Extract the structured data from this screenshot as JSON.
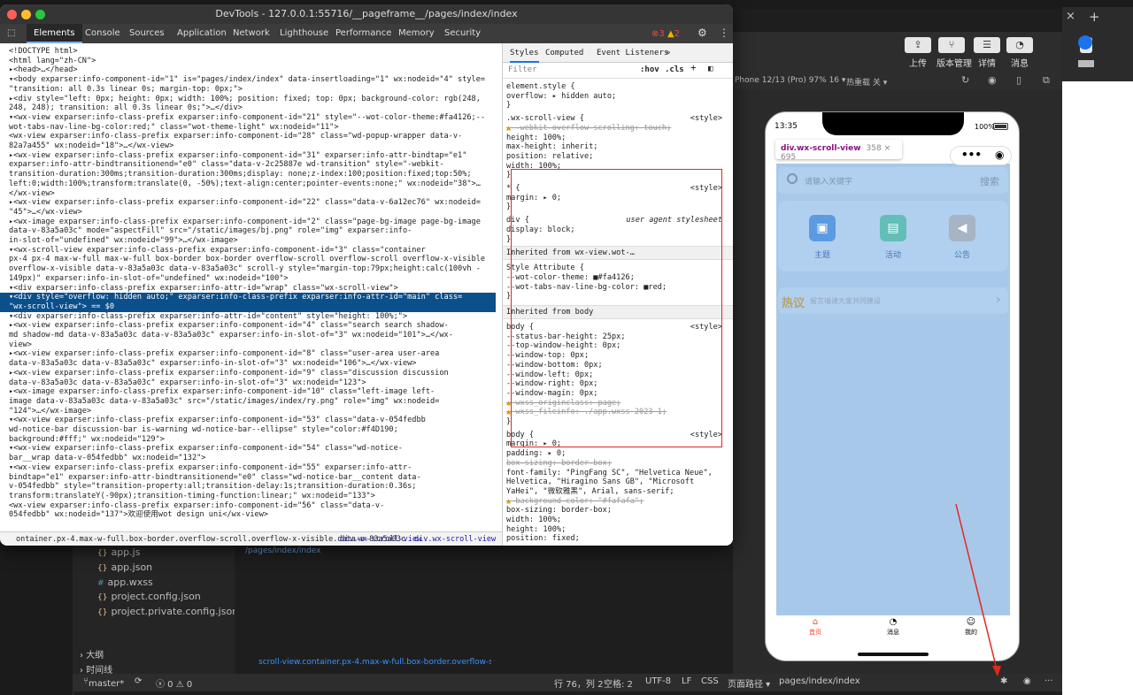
{
  "devtools": {
    "title": "DevTools - 127.0.0.1:55716/__pageframe__/pages/index/index",
    "tabs": [
      "Elements",
      "Console",
      "Sources",
      "Application",
      "Network",
      "Lighthouse",
      "Performance",
      "Memory",
      "Security"
    ],
    "errors": "3",
    "warnings": "2",
    "elements_lines": [
      "<!DOCTYPE html>",
      "<html lang=\"zh-CN\">",
      "▸<head>…</head>",
      "▾<body exparser:info-component-id=\"1\" is=\"pages/index/index\" data-insertloading=\"1\" wx:nodeid=\"4\" style=",
      "\"transition: all 0.3s linear 0s; margin-top: 0px;\">",
      "  ▸<div style=\"left: 0px; height: 0px; width: 100%; position: fixed; top: 0px; background-color: rgb(248,",
      "  248, 248); transition: all 0.3s linear 0s;\">…</div>",
      "  ▾<wx-view exparser:info-class-prefix exparser:info-component-id=\"21\" style=\"--wot-color-theme:#fa4126;--",
      "  wot-tabs-nav-line-bg-color:red;\" class=\"wot-theme-light\" wx:nodeid=\"11\">",
      "     <wx-view exparser:info-class-prefix exparser:info-component-id=\"28\" class=\"wd-popup-wrapper data-v-",
      "     82a7a455\" wx:nodeid=\"18\">…</wx-view>",
      "   ▸<wx-view exparser:info-class-prefix exparser:info-component-id=\"31\" exparser:info-attr-bindtap=\"e1\"",
      "   exparser:info-attr-bindtransitionend=\"e0\" class=\"data-v-2c25887e wd-transition\" style=\"-webkit-",
      "   transition-duration:300ms;transition-duration:300ms;display: none;z-index:100;position:fixed;top:50%;",
      "   left:0;width:100%;transform:translate(0, -50%);text-align:center;pointer-events:none;\" wx:nodeid=\"38\">…",
      "   </wx-view>",
      "   ▸<wx-view exparser:info-class-prefix exparser:info-component-id=\"22\" class=\"data-v-6a12ec76\" wx:nodeid=",
      "   \"45\">…</wx-view>",
      "   ▸<wx-image exparser:info-class-prefix exparser:info-component-id=\"2\" class=\"page-bg-image page-bg-image",
      "   data-v-83a5a03c\" mode=\"aspectFill\" src=\"/static/images/bj.png\" role=\"img\" exparser:info-",
      "   in-slot-of=\"undefined\" wx:nodeid=\"99\">…</wx-image>",
      "   ▾<wx-scroll-view exparser:info-class-prefix exparser:info-component-id=\"3\" class=\"container",
      "   px-4 px-4 max-w-full max-w-full box-border box-border overflow-scroll overflow-scroll overflow-x-visible",
      "   overflow-x-visible data-v-83a5a03c data-v-83a5a03c\" scroll-y style=\"margin-top:79px;height:calc(100vh -",
      "   149px)\" exparser:info-in-slot-of=\"undefined\" wx:nodeid=\"100\">",
      "     ▾<div exparser:info-class-prefix exparser:info-attr-id=\"wrap\" class=\"wx-scroll-view\">",
      "       ▾<div style=\"overflow: hidden auto;\" exparser:info-class-prefix exparser:info-attr-id=\"main\" class=",
      "       \"wx-scroll-view\"> == $0",
      "         ▾<div exparser:info-class-prefix exparser:info-attr-id=\"content\" style=\"height: 100%;\">",
      "           ▸<wx-view exparser:info-class-prefix exparser:info-component-id=\"4\" class=\"search search shadow-",
      "           md shadow-md data-v-83a5a03c data-v-83a5a03c\" exparser:info-in-slot-of=\"3\" wx:nodeid=\"101\">…</wx-",
      "           view>",
      "           ▸<wx-view exparser:info-class-prefix exparser:info-component-id=\"8\" class=\"user-area user-area",
      "           data-v-83a5a03c data-v-83a5a03c\" exparser:info-in-slot-of=\"3\" wx:nodeid=\"106\">…</wx-view>",
      "           ▸<wx-view exparser:info-class-prefix exparser:info-component-id=\"9\" class=\"discussion discussion",
      "           data-v-83a5a03c data-v-83a5a03c\" exparser:info-in-slot-of=\"3\" wx:nodeid=\"123\">",
      "             ▸<wx-image exparser:info-class-prefix exparser:info-component-id=\"10\" class=\"left-image left-",
      "             image data-v-83a5a03c data-v-83a5a03c\" src=\"/static/images/index/ry.png\" role=\"img\" wx:nodeid=",
      "             \"124\">…</wx-image>",
      "             ▾<wx-view exparser:info-class-prefix exparser:info-component-id=\"53\" class=\"data-v-054fedbb",
      "             wd-notice-bar discussion-bar is-warning wd-notice-bar--ellipse\" style=\"color:#f4D190;",
      "             background:#fff;\" wx:nodeid=\"129\">",
      "               ▾<wx-view exparser:info-class-prefix exparser:info-component-id=\"54\" class=\"wd-notice-",
      "               bar__wrap data-v-054fedbb\" wx:nodeid=\"132\">",
      "                 ▾<wx-view exparser:info-class-prefix exparser:info-component-id=\"55\" exparser:info-attr-",
      "                 bindtap=\"e1\" exparser:info-attr-bindtransitionend=\"e0\" class=\"wd-notice-bar__content data-",
      "                 v-054fedbb\" style=\"transition-property:all;transition-delay:1s;transition-duration:0.36s;",
      "                 transform:translateY(-90px);transition-timing-function:linear;\" wx:nodeid=\"133\">",
      "                   <wx-view exparser:info-class-prefix exparser:info-component-id=\"56\" class=\"data-v-",
      "                   054fedbb\" wx:nodeid=\"137\">欢迎使用wot design uni</wx-view>"
    ],
    "breadcrumb": [
      "ontainer.px-4.max-w-full.box-border.overflow-scroll.overflow-x-visible.data-v-83a5a03c",
      "div.wx-scroll-view",
      "div.wx-scroll-view"
    ],
    "styles_tabs": [
      "Styles",
      "Computed",
      "Event Listeners",
      "»"
    ],
    "filter_placeholder": "Filter",
    "hov": ":hov",
    "cls": ".cls",
    "styles_lines": [
      {
        "t": "element.style {"
      },
      {
        "t": "  overflow: ▸ hidden auto;"
      },
      {
        "t": "}"
      },
      {
        "t": ".wx-scroll-view {",
        "r": "<style>"
      },
      {
        "t": "  -webkit-overflow-scrolling: touch;",
        "s": true,
        "w": true
      },
      {
        "t": "  height: 100%;"
      },
      {
        "t": "  max-height: inherit;"
      },
      {
        "t": "  position: relative;"
      },
      {
        "t": "  width: 100%;"
      },
      {
        "t": "}"
      },
      {
        "t": "* {",
        "r": "<style>"
      },
      {
        "t": "  margin: ▸ 0;"
      },
      {
        "t": "}"
      },
      {
        "t": "div {",
        "r": "user agent stylesheet"
      },
      {
        "t": "  display: block;"
      },
      {
        "t": "}"
      }
    ],
    "inherited1": "Inherited from wx-view.wot-…",
    "style_attr": [
      {
        "t": "Style Attribute {"
      },
      {
        "t": "  --wot-color-theme: ■#fa4126;"
      },
      {
        "t": "  --wot-tabs-nav-line-bg-color: ■red;"
      },
      {
        "t": "}"
      }
    ],
    "inherited2": "Inherited from body",
    "body_lines": [
      {
        "t": "body {",
        "r": "<style>"
      },
      {
        "t": "  --status-bar-height: 25px;"
      },
      {
        "t": "  --top-window-height: 0px;"
      },
      {
        "t": "  --window-top: 0px;"
      },
      {
        "t": "  --window-bottom: 0px;"
      },
      {
        "t": "  --window-left: 0px;"
      },
      {
        "t": "  --window-right: 0px;"
      },
      {
        "t": "  --window-magin: 0px;"
      },
      {
        "t": "  wxss_originclass: page;",
        "s": true,
        "w": true
      },
      {
        "t": "  wxss_fileinfo: ./app.wxss 2023 1;",
        "s": true,
        "w": true
      },
      {
        "t": "}"
      },
      {
        "t": "body {",
        "r": "<style>"
      },
      {
        "t": "  margin: ▸ 0;"
      },
      {
        "t": "  padding: ▸ 0;"
      },
      {
        "t": "  box-sizing: border-box;",
        "s": true
      },
      {
        "t": "  font-family: \"PingFang SC\", \"Helvetica Neue\","
      },
      {
        "t": "      Helvetica, \"Hiragino Sans GB\", \"Microsoft"
      },
      {
        "t": "      YaHei\", \"微软雅黑\", Arial, sans-serif;"
      },
      {
        "t": "  background-color: \"#fafafa\";",
        "s": true,
        "w": true
      },
      {
        "t": "  box-sizing: border-box;"
      },
      {
        "t": "  width: 100%;"
      },
      {
        "t": "  height: 100%;"
      },
      {
        "t": "  position: fixed;"
      }
    ]
  },
  "toolbar": {
    "items": [
      "上传",
      "版本管理",
      "详情",
      "消息"
    ]
  },
  "sim": {
    "device": "Phone 12/13 (Pro) 97% 16 ▾",
    "hotreload": "热重载 关 ▾"
  },
  "phone": {
    "time": "13:35",
    "battery": "100%",
    "tooltip_tag": "div.wx-scroll-view",
    "tooltip_size": "358 × 695",
    "search_placeholder": "请输入关键字",
    "search_button": "搜索",
    "user_items": [
      "主题",
      "活动",
      "公告"
    ],
    "hot_label": "热议",
    "hot_text": "留言墙请大家共同建设",
    "tabs": [
      "首页",
      "消息",
      "我的"
    ]
  },
  "ide": {
    "tabs_plus": "+",
    "tabs_close": "×",
    "files": [
      "app.js",
      "app.json",
      "app.wxss",
      "project.config.json",
      "project.private.config.json"
    ],
    "outline": "大纲",
    "timeline": "时间线",
    "editor_path": "/pages/index/index",
    "bottom_path": "scroll-view.container.px-4.max-w-full.box-border.overflow-s",
    "status": {
      "branch": "master*",
      "errors": "ⓧ 0 ⚠ 0",
      "position": "行 76，列 2",
      "spaces": "空格: 2",
      "encoding": "UTF-8",
      "eol": "LF",
      "lang": "CSS",
      "page_path_label": "页面路径 ▾",
      "page_path": "pages/index/index"
    }
  },
  "colors": {
    "accent": "#fa4126",
    "selection": "#0b4f8b",
    "annotation": "#e3281e"
  }
}
